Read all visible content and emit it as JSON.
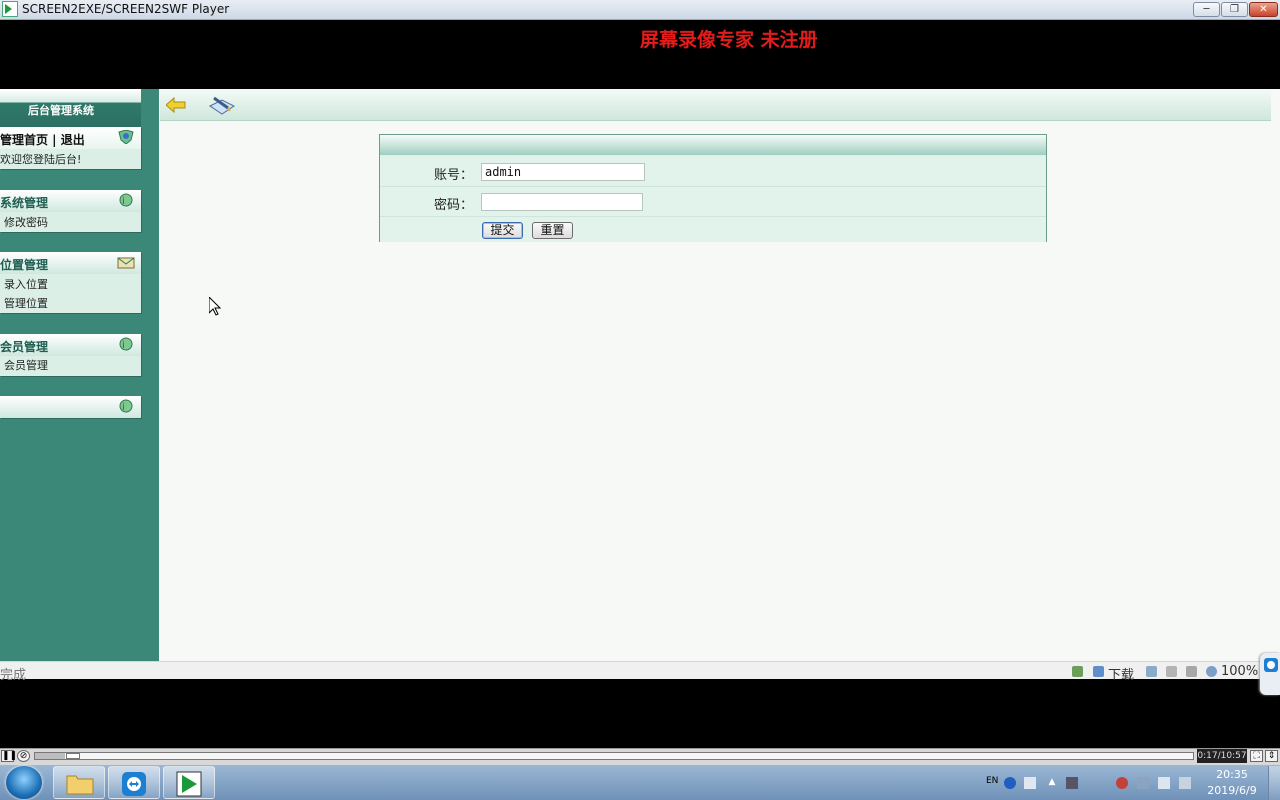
{
  "window": {
    "title": "SCREEN2EXE/SCREEN2SWF Player",
    "minimize_label": "─",
    "maximize_label": "❐",
    "close_label": "✕"
  },
  "banner": "屏幕录像专家  未注册",
  "sidebar": {
    "header": "后台管理系统",
    "panels": [
      {
        "title": "管理首页 | 退出",
        "items": [
          "欢迎您登陆后台!"
        ],
        "icon": "user-shield-icon"
      },
      {
        "title": "系统管理",
        "items": [
          "修改密码"
        ],
        "icon": "info-icon"
      },
      {
        "title": "位置管理",
        "items": [
          "录入位置",
          "管理位置"
        ],
        "icon": "mail-folder-icon"
      },
      {
        "title": "会员管理",
        "items": [
          "会员管理"
        ],
        "icon": "info-icon"
      },
      {
        "title": "",
        "items": [],
        "icon": "info-icon"
      }
    ]
  },
  "toolbar": {
    "back_icon": "back-arrow-icon",
    "book_icon": "book-pen-icon"
  },
  "form": {
    "account_label": "账号：",
    "account_value": "admin",
    "password_label": "密码：",
    "password_value": "",
    "submit_label": "提交",
    "reset_label": "重置"
  },
  "statusbar": {
    "status": "完成",
    "download": "下载",
    "zoom": "100%"
  },
  "player": {
    "time": "0:17/10:57",
    "progress": 0.026
  },
  "taskbar": {
    "apps": [
      "file-explorer-icon",
      "teamviewer-icon",
      "screen-player-icon"
    ],
    "language": "EN",
    "time": "20:35",
    "date": "2019/6/9"
  },
  "colors": {
    "sidebar_bg": "#3b8878",
    "banner_red": "#e41b1b",
    "form_bg": "#dff2ea"
  }
}
